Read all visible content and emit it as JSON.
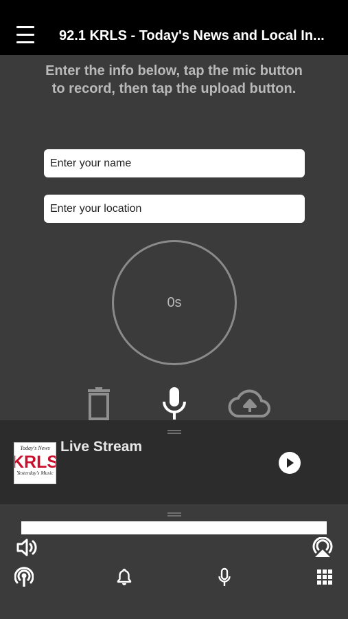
{
  "header": {
    "title": "92.1 KRLS - Today's News and Local In..."
  },
  "instructions": "Enter the info below, tap the mic button to record, then tap the upload button.",
  "form": {
    "name_placeholder": "Enter your name",
    "location_placeholder": "Enter your location"
  },
  "recorder": {
    "elapsed": "0s"
  },
  "player": {
    "stream_title": "Live Stream",
    "album_art": {
      "top_text": "Today's News",
      "brand": "KRLS",
      "bottom_text": "Yesterday's Music"
    }
  },
  "icons": {
    "menu": "hamburger-menu-icon",
    "delete": "trash-icon",
    "mic": "microphone-icon",
    "upload": "cloud-upload-icon",
    "play": "play-icon",
    "volume": "volume-icon",
    "airplay": "airplay-icon",
    "broadcast": "broadcast-icon",
    "notifications": "bell-icon",
    "record_nav": "microphone-icon",
    "more": "grid-icon"
  },
  "colors": {
    "header_bg": "#000000",
    "page_bg": "#3b3b3b",
    "player_bg": "#2c2c2c",
    "brand_red": "#c8102e",
    "muted_text": "#b9b9b9"
  }
}
